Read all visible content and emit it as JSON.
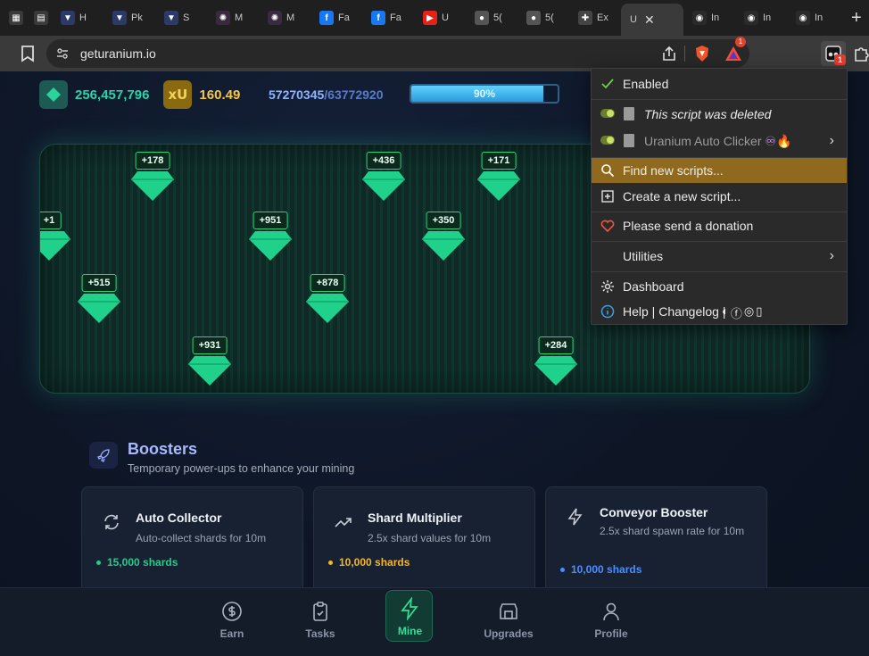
{
  "tabs": [
    {
      "label": "",
      "fav": "▦",
      "color": "#3a3a3a"
    },
    {
      "label": "",
      "fav": "▤",
      "color": "#3a3a3a"
    },
    {
      "label": "H",
      "fav": "▼",
      "color": "#2b3a66"
    },
    {
      "label": "Pk",
      "fav": "▼",
      "color": "#2b3a66"
    },
    {
      "label": "S",
      "fav": "▼",
      "color": "#2b3a66"
    },
    {
      "label": "M",
      "fav": "✺",
      "color": "#3a2a40"
    },
    {
      "label": "M",
      "fav": "✺",
      "color": "#3a2a40"
    },
    {
      "label": "Fa",
      "fav": "f",
      "color": "#1877f2"
    },
    {
      "label": "Fa",
      "fav": "f",
      "color": "#1877f2"
    },
    {
      "label": "U",
      "fav": "▶",
      "color": "#e62117"
    },
    {
      "label": "5(",
      "fav": "●",
      "color": "#555555"
    },
    {
      "label": "5(",
      "fav": "●",
      "color": "#555555"
    },
    {
      "label": "Ex",
      "fav": "✚",
      "color": "#444444"
    },
    {
      "label": "U",
      "fav": "",
      "color": "#3a3a3a",
      "active": true
    },
    {
      "label": "In",
      "fav": "◉",
      "color": "#2a2a2a"
    },
    {
      "label": "In",
      "fav": "◉",
      "color": "#2a2a2a"
    },
    {
      "label": "In",
      "fav": "◉",
      "color": "#2a2a2a"
    }
  ],
  "toolbar": {
    "url": "geturanium.io",
    "ext_badge_brave_alert": "1",
    "ext_badge_tampermonkey": "1"
  },
  "stats": {
    "shards": "256,457,796",
    "xu_label": "xU",
    "xu_value": "160.49",
    "progress_current": "57270345",
    "progress_total": "/63772920",
    "progress_percent_label": "90%",
    "progress_fraction": 0.9
  },
  "shards": [
    {
      "label": "+178"
    },
    {
      "label": "+436"
    },
    {
      "label": "+171"
    },
    {
      "label": "+1"
    },
    {
      "label": "+951"
    },
    {
      "label": "+350"
    },
    {
      "label": "+515"
    },
    {
      "label": "+878"
    },
    {
      "label": "+931"
    },
    {
      "label": "+284"
    }
  ],
  "boosters": {
    "title": "Boosters",
    "subtitle": "Temporary power-ups to enhance your mining",
    "cards": [
      {
        "title": "Auto Collector",
        "desc": "Auto-collect shards for 10m",
        "price": "15,000 shards",
        "color": "#29c98a",
        "icon": "refresh-icon"
      },
      {
        "title": "Shard Multiplier",
        "desc": "2.5x shard values for 10m",
        "price": "10,000 shards",
        "color": "#f4b52a",
        "icon": "trend-up-icon"
      },
      {
        "title": "Conveyor Booster",
        "desc": "2.5x shard spawn rate for 10m",
        "price": "10,000 shards",
        "color": "#4d8dff",
        "icon": "bolt-icon"
      }
    ]
  },
  "nav": {
    "earn": "Earn",
    "tasks": "Tasks",
    "mine": "Mine",
    "upgrades": "Upgrades",
    "profile": "Profile"
  },
  "menu": {
    "enabled": "Enabled",
    "script1": "This script was deleted",
    "script2": "Uranium Auto Clicker",
    "script2_emoji": "♾🔥",
    "find": "Find new scripts...",
    "create": "Create a new script...",
    "donate": "Please send a donation",
    "utilities": "Utilities",
    "dashboard": "Dashboard",
    "help": "Help | Changelog |"
  }
}
